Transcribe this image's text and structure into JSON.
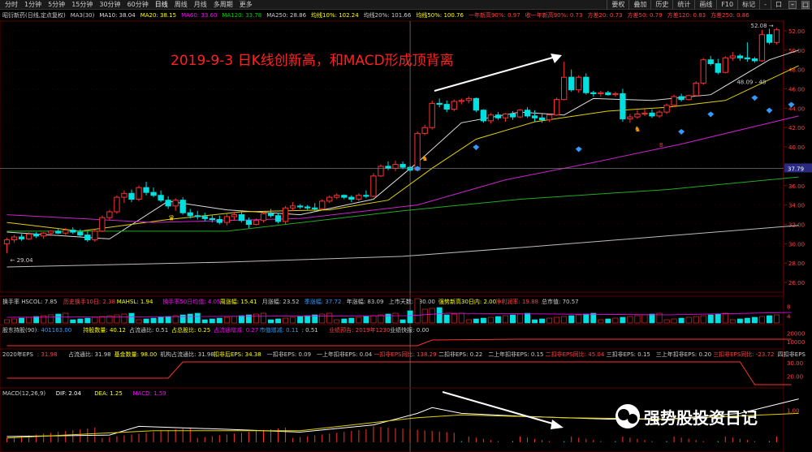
{
  "toolbar": {
    "periods": [
      "分时",
      "1分钟",
      "5分钟",
      "15分钟",
      "30分钟",
      "60分钟",
      "日线",
      "周线",
      "月线",
      "多周期",
      "更多"
    ],
    "active_period": "日线",
    "tools": [
      "要权",
      "叠加",
      "历史",
      "统计",
      "画线",
      "F10",
      "标记",
      "-",
      "口"
    ]
  },
  "info_line": [
    {
      "text": "昭衍新药(日线,定点复权)",
      "color": "#cccccc"
    },
    {
      "text": "MA3(30)",
      "color": "#cccccc"
    },
    {
      "text": "MA10: 38.04",
      "color": "#dddddd"
    },
    {
      "text": "MA20: 38.15",
      "color": "#ffff00"
    },
    {
      "text": "MA60: 33.60",
      "color": "#ff00ff"
    },
    {
      "text": "MA120: 33.78",
      "color": "#00cc00"
    },
    {
      "text": "MA250: 28.86",
      "color": "#cccccc"
    },
    {
      "text": "均线10%: 102.24",
      "color": "#ffff00"
    },
    {
      "text": "均线20%: 101.66",
      "color": "#cccccc"
    },
    {
      "text": "均线50%: 100.76",
      "color": "#ffff00"
    },
    {
      "text": "一年新高90%: 0.97",
      "color": "#ff4040"
    },
    {
      "text": "收一年新高90%: 0.73",
      "color": "#ff4040"
    },
    {
      "text": "方差20: 0.73",
      "color": "#ff4040"
    },
    {
      "text": "方差50: 0.79",
      "color": "#ff4040"
    },
    {
      "text": "方差120: 0.83",
      "color": "#ff4040"
    },
    {
      "text": "方差250: 0.86",
      "color": "#ff4040"
    }
  ],
  "annotation": {
    "text": "2019-9-3 日K线创新高，和MACD形成顶背离",
    "color": "#ff2020"
  },
  "watermark": "强势股投资日记",
  "price_labels": {
    "high": "52.08",
    "low": "29.04",
    "ma_label": "48.09 - 48",
    "current": "37.79"
  },
  "chart_data": {
    "type": "candlestick",
    "y_axis": {
      "ticks": [
        "52.00",
        "50.00",
        "48.00",
        "46.00",
        "44.00",
        "42.00",
        "40.00",
        "38.00",
        "36.00",
        "34.00",
        "32.00",
        "30.00",
        "28.00",
        "26.00"
      ],
      "ylim": [
        25,
        53
      ]
    },
    "candles": [
      [
        30.0,
        30.6,
        29.04,
        30.4
      ],
      [
        30.4,
        30.9,
        30.1,
        30.7
      ],
      [
        30.7,
        31.0,
        30.3,
        30.5
      ],
      [
        30.5,
        31.2,
        30.4,
        31.0
      ],
      [
        31.0,
        31.2,
        30.6,
        30.8
      ],
      [
        30.8,
        31.2,
        30.5,
        31.1
      ],
      [
        31.1,
        31.4,
        30.8,
        31.3
      ],
      [
        31.3,
        31.6,
        31.0,
        31.1
      ],
      [
        31.1,
        31.6,
        30.9,
        31.4
      ],
      [
        31.4,
        31.7,
        31.0,
        31.2
      ],
      [
        31.2,
        31.5,
        30.7,
        30.9
      ],
      [
        30.9,
        31.3,
        30.2,
        30.4
      ],
      [
        30.4,
        31.5,
        30.2,
        31.3
      ],
      [
        31.3,
        32.9,
        31.2,
        32.7
      ],
      [
        32.7,
        33.5,
        32.4,
        33.3
      ],
      [
        33.3,
        35.0,
        33.1,
        34.8
      ],
      [
        34.8,
        35.5,
        34.2,
        35.2
      ],
      [
        35.2,
        35.6,
        34.3,
        34.6
      ],
      [
        34.6,
        36.0,
        34.4,
        35.8
      ],
      [
        35.8,
        36.4,
        35.0,
        35.3
      ],
      [
        35.3,
        35.8,
        34.8,
        35.0
      ],
      [
        35.0,
        35.5,
        34.3,
        34.5
      ],
      [
        34.5,
        34.9,
        33.6,
        33.9
      ],
      [
        33.9,
        34.7,
        33.4,
        34.5
      ],
      [
        34.5,
        34.8,
        33.0,
        33.2
      ],
      [
        33.2,
        33.6,
        32.6,
        32.9
      ],
      [
        32.9,
        33.4,
        32.5,
        32.8
      ],
      [
        32.8,
        33.2,
        32.3,
        32.6
      ],
      [
        32.6,
        33.0,
        32.2,
        32.5
      ],
      [
        32.5,
        32.9,
        32.0,
        32.2
      ],
      [
        32.2,
        33.1,
        31.9,
        32.8
      ],
      [
        32.8,
        33.3,
        32.4,
        33.0
      ],
      [
        33.0,
        33.3,
        32.2,
        32.4
      ],
      [
        32.4,
        32.7,
        31.6,
        32.0
      ],
      [
        32.0,
        32.6,
        31.9,
        32.4
      ],
      [
        32.4,
        33.3,
        32.2,
        33.1
      ],
      [
        33.1,
        33.6,
        32.7,
        32.9
      ],
      [
        32.9,
        33.2,
        32.1,
        32.3
      ],
      [
        32.3,
        33.9,
        32.0,
        33.7
      ],
      [
        33.7,
        34.3,
        33.4,
        33.9
      ],
      [
        33.9,
        34.1,
        33.6,
        33.8
      ],
      [
        33.8,
        34.0,
        33.5,
        33.7
      ],
      [
        33.7,
        34.2,
        33.4,
        33.6
      ],
      [
        33.6,
        34.6,
        33.5,
        34.4
      ],
      [
        34.4,
        35.0,
        34.2,
        34.8
      ],
      [
        34.8,
        35.2,
        34.6,
        35.0
      ],
      [
        35.0,
        35.1,
        34.6,
        34.8
      ],
      [
        34.8,
        35.0,
        34.3,
        34.6
      ],
      [
        34.6,
        35.2,
        34.4,
        35.0
      ],
      [
        35.0,
        35.5,
        34.7,
        34.9
      ],
      [
        34.9,
        37.3,
        34.8,
        37.0
      ],
      [
        37.0,
        38.2,
        36.9,
        38.0
      ],
      [
        38.0,
        38.5,
        37.6,
        37.8
      ],
      [
        37.8,
        38.6,
        37.5,
        38.2
      ],
      [
        38.2,
        38.5,
        37.7,
        37.9
      ],
      [
        37.9,
        38.1,
        37.4,
        37.6
      ],
      [
        37.6,
        41.6,
        37.5,
        41.4
      ],
      [
        41.4,
        42.3,
        41.2,
        42.0
      ],
      [
        42.0,
        44.8,
        41.8,
        44.5
      ],
      [
        44.5,
        45.0,
        44.1,
        44.4
      ],
      [
        44.4,
        44.8,
        43.6,
        43.9
      ],
      [
        43.9,
        44.9,
        43.7,
        44.7
      ],
      [
        44.7,
        45.0,
        44.4,
        44.8
      ],
      [
        44.8,
        45.2,
        44.5,
        45.0
      ],
      [
        45.0,
        45.1,
        43.6,
        43.8
      ],
      [
        43.8,
        43.9,
        42.5,
        42.7
      ],
      [
        42.7,
        43.5,
        42.4,
        43.3
      ],
      [
        43.3,
        43.6,
        42.8,
        43.0
      ],
      [
        43.0,
        43.5,
        42.6,
        43.4
      ],
      [
        43.4,
        43.7,
        42.8,
        43.1
      ],
      [
        43.1,
        43.9,
        43.0,
        43.8
      ],
      [
        43.8,
        44.1,
        43.0,
        43.2
      ],
      [
        43.2,
        43.8,
        42.6,
        43.0
      ],
      [
        43.0,
        43.4,
        42.5,
        42.8
      ],
      [
        42.8,
        43.4,
        42.6,
        43.3
      ],
      [
        43.3,
        45.1,
        43.2,
        44.9
      ],
      [
        44.9,
        48.8,
        44.8,
        47.2
      ],
      [
        47.2,
        48.0,
        45.7,
        45.9
      ],
      [
        45.9,
        47.4,
        45.6,
        47.2
      ],
      [
        47.2,
        47.6,
        45.4,
        45.6
      ],
      [
        45.6,
        45.8,
        45.2,
        45.5
      ],
      [
        45.5,
        45.8,
        45.2,
        45.6
      ],
      [
        45.6,
        45.8,
        45.3,
        45.4
      ],
      [
        45.4,
        45.7,
        45.2,
        45.5
      ],
      [
        45.5,
        46.0,
        42.6,
        42.9
      ],
      [
        42.9,
        43.4,
        42.5,
        43.1
      ],
      [
        43.1,
        43.8,
        42.9,
        43.4
      ],
      [
        43.4,
        43.9,
        43.2,
        43.5
      ],
      [
        43.5,
        43.9,
        43.0,
        43.2
      ],
      [
        43.2,
        43.8,
        43.0,
        43.6
      ],
      [
        43.6,
        44.5,
        43.4,
        44.3
      ],
      [
        44.3,
        45.4,
        44.1,
        45.2
      ],
      [
        45.2,
        45.5,
        44.7,
        44.9
      ],
      [
        44.9,
        45.4,
        44.8,
        45.3
      ],
      [
        45.3,
        46.8,
        45.2,
        46.6
      ],
      [
        46.6,
        49.2,
        46.4,
        49.0
      ],
      [
        49.0,
        49.4,
        48.4,
        48.6
      ],
      [
        48.6,
        49.1,
        47.5,
        47.7
      ],
      [
        47.7,
        49.4,
        47.6,
        49.2
      ],
      [
        49.2,
        49.8,
        48.9,
        49.4
      ],
      [
        49.4,
        49.6,
        48.9,
        49.2
      ],
      [
        49.2,
        50.8,
        48.8,
        49.1
      ],
      [
        49.1,
        49.3,
        48.7,
        48.9
      ],
      [
        48.9,
        52.08,
        48.8,
        51.6
      ],
      [
        51.6,
        52.2,
        50.6,
        50.8
      ],
      [
        50.8,
        52.3,
        50.6,
        52.1
      ]
    ],
    "ma_lines": [
      {
        "label": "MA10",
        "color": "#dddddd",
        "points": [
          [
            0,
            31.2
          ],
          [
            14,
            30.5
          ],
          [
            22,
            34.4
          ],
          [
            30,
            33.5
          ],
          [
            40,
            33.0
          ],
          [
            50,
            34.6
          ],
          [
            56,
            38.4
          ],
          [
            62,
            42.5
          ],
          [
            70,
            43.6
          ],
          [
            76,
            43.3
          ],
          [
            80,
            45.0
          ],
          [
            88,
            44.8
          ],
          [
            96,
            45.4
          ],
          [
            104,
            49.0
          ],
          [
            108,
            50.0
          ]
        ]
      },
      {
        "label": "MA20",
        "color": "#e0d000",
        "points": [
          [
            0,
            32.2
          ],
          [
            10,
            31.3
          ],
          [
            22,
            32.5
          ],
          [
            32,
            33.3
          ],
          [
            44,
            33.5
          ],
          [
            52,
            34.5
          ],
          [
            58,
            37.8
          ],
          [
            64,
            40.8
          ],
          [
            72,
            42.6
          ],
          [
            82,
            43.7
          ],
          [
            90,
            44.1
          ],
          [
            98,
            44.8
          ],
          [
            108,
            48.4
          ]
        ]
      },
      {
        "label": "MA60",
        "color": "#cc22cc",
        "points": [
          [
            0,
            33.0
          ],
          [
            20,
            32.2
          ],
          [
            40,
            32.6
          ],
          [
            56,
            34.0
          ],
          [
            68,
            36.6
          ],
          [
            80,
            38.4
          ],
          [
            92,
            40.3
          ],
          [
            108,
            43.2
          ]
        ]
      },
      {
        "label": "MA120",
        "color": "#22aa22",
        "points": [
          [
            0,
            31.3
          ],
          [
            30,
            31.3
          ],
          [
            54,
            33.4
          ],
          [
            70,
            34.6
          ],
          [
            90,
            35.6
          ],
          [
            108,
            36.9
          ]
        ]
      },
      {
        "label": "MA250",
        "color": "#bbbbbb",
        "points": [
          [
            0,
            27.6
          ],
          [
            30,
            28.1
          ],
          [
            54,
            28.7
          ],
          [
            70,
            29.6
          ],
          [
            90,
            30.8
          ],
          [
            108,
            31.9
          ]
        ]
      }
    ],
    "macd": {
      "dif": [
        [
          0,
          0.2
        ],
        [
          14,
          0.25
        ],
        [
          18,
          0.55
        ],
        [
          30,
          0.45
        ],
        [
          40,
          0.35
        ],
        [
          50,
          0.6
        ],
        [
          56,
          1.0
        ],
        [
          58,
          1.2
        ],
        [
          62,
          1.0
        ],
        [
          70,
          0.9
        ],
        [
          76,
          0.85
        ],
        [
          82,
          0.8
        ],
        [
          90,
          0.8
        ],
        [
          100,
          1.0
        ],
        [
          108,
          1.5
        ]
      ],
      "dea": [
        [
          0,
          0.15
        ],
        [
          20,
          0.4
        ],
        [
          40,
          0.4
        ],
        [
          56,
          0.85
        ],
        [
          62,
          0.95
        ],
        [
          76,
          0.85
        ],
        [
          90,
          0.8
        ],
        [
          108,
          1.0
        ]
      ],
      "yrange": [
        0,
        1.6
      ]
    }
  },
  "panes": {
    "turnover": {
      "header": [
        {
          "text": "换手率 HSCOL: 7.85",
          "color": "#cccccc"
        },
        {
          "text": "历史换手10日: 2.38",
          "color": "#ff4040"
        },
        {
          "text": "MAHSL: 1.94",
          "color": "#ffff00"
        },
        {
          "text": "换手率50日均值: 4.05",
          "color": "#ff00ff"
        },
        {
          "text": "周涨幅: 15.41",
          "color": "#ffff00"
        },
        {
          "text": "月涨幅: 23.52",
          "color": "#cccccc"
        },
        {
          "text": "季涨幅: 37.72",
          "color": "#3399ff"
        },
        {
          "text": "年涨幅: 83.09",
          "color": "#cccccc"
        },
        {
          "text": "上市天数: 480.00",
          "color": "#cccccc"
        },
        {
          "text": "强势新高30日内: 2.00",
          "color": "#ffff00"
        },
        {
          "text": "净利润率: 19.88",
          "color": "#ff4040"
        },
        {
          "text": "总市值: 70.57",
          "color": "#cccccc"
        }
      ],
      "ticks": [
        "8",
        "4"
      ]
    },
    "holders": {
      "header": [
        {
          "text": "股东持股(90)",
          "color": "#cccccc"
        },
        {
          "text": ": 401163.00",
          "color": "#3399ff"
        },
        {
          "text": "持股数量: 40.12",
          "color": "#ffff00"
        },
        {
          "text": "占流通比: 0.51",
          "color": "#cccccc"
        },
        {
          "text": "占总股比: 0.25",
          "color": "#ffff00"
        },
        {
          "text": "占流通增减: 0.27",
          "color": "#ff00ff"
        },
        {
          "text": "市值增减: 0.11",
          "color": "#3399ff"
        },
        {
          "text": ": 0.51",
          "color": "#cccccc"
        },
        {
          "text": "业绩预告: 2019年1230",
          "color": "#ff4040"
        },
        {
          "text": "业绩快报: 0.00",
          "color": "#cccccc"
        }
      ],
      "ticks": [
        "20000",
        "10000"
      ]
    },
    "eps": {
      "header": [
        {
          "text": "2020年EPS",
          "color": "#cccccc"
        },
        {
          "text": ": 31.98",
          "color": "#ff4040"
        },
        {
          "text": "占流通比: 31.98",
          "color": "#cccccc"
        },
        {
          "text": "基金数量: 98.00",
          "color": "#ffff00"
        },
        {
          "text": "机构占流通比: 31.98",
          "color": "#cccccc"
        },
        {
          "text": "扣非后EPS: 34.38",
          "color": "#ffff00"
        },
        {
          "text": "一扣非EPS: 0.09",
          "color": "#cccccc"
        },
        {
          "text": "一上年扣非EPS: 0.04",
          "color": "#cccccc"
        },
        {
          "text": "一扣非EPS同比: 138.29",
          "color": "#ff4040"
        },
        {
          "text": "二扣非EPS: 0.22",
          "color": "#cccccc"
        },
        {
          "text": "二上年扣非EPS: 0.15",
          "color": "#cccccc"
        },
        {
          "text": "二扣非EPS同比: 45.04",
          "color": "#ff4040"
        },
        {
          "text": "三扣非EPS: 0.15",
          "color": "#cccccc"
        },
        {
          "text": "三上年扣非EPS: 0.20",
          "color": "#cccccc"
        },
        {
          "text": "三扣非EPS同比: -23.72",
          "color": "#ff4040"
        },
        {
          "text": "四扣非EPS",
          "color": "#cccccc"
        }
      ],
      "ticks": [
        "30.00",
        "20.00"
      ]
    },
    "macd": {
      "header": [
        {
          "text": "MACD(12,26,9)",
          "color": "#cccccc"
        },
        {
          "text": "DIF: 2.04",
          "color": "#ffffff"
        },
        {
          "text": "DEA: 1.25",
          "color": "#ffff00"
        },
        {
          "text": "MACD: 1.59",
          "color": "#ff00ff"
        }
      ],
      "ticks": [
        "1.00"
      ]
    }
  },
  "colors": {
    "up": "#ff3030",
    "down": "#00e0e0",
    "axis": "#8b0000",
    "grid": "#5a0000",
    "text": "#cccccc",
    "annotation": "#ff2020"
  }
}
